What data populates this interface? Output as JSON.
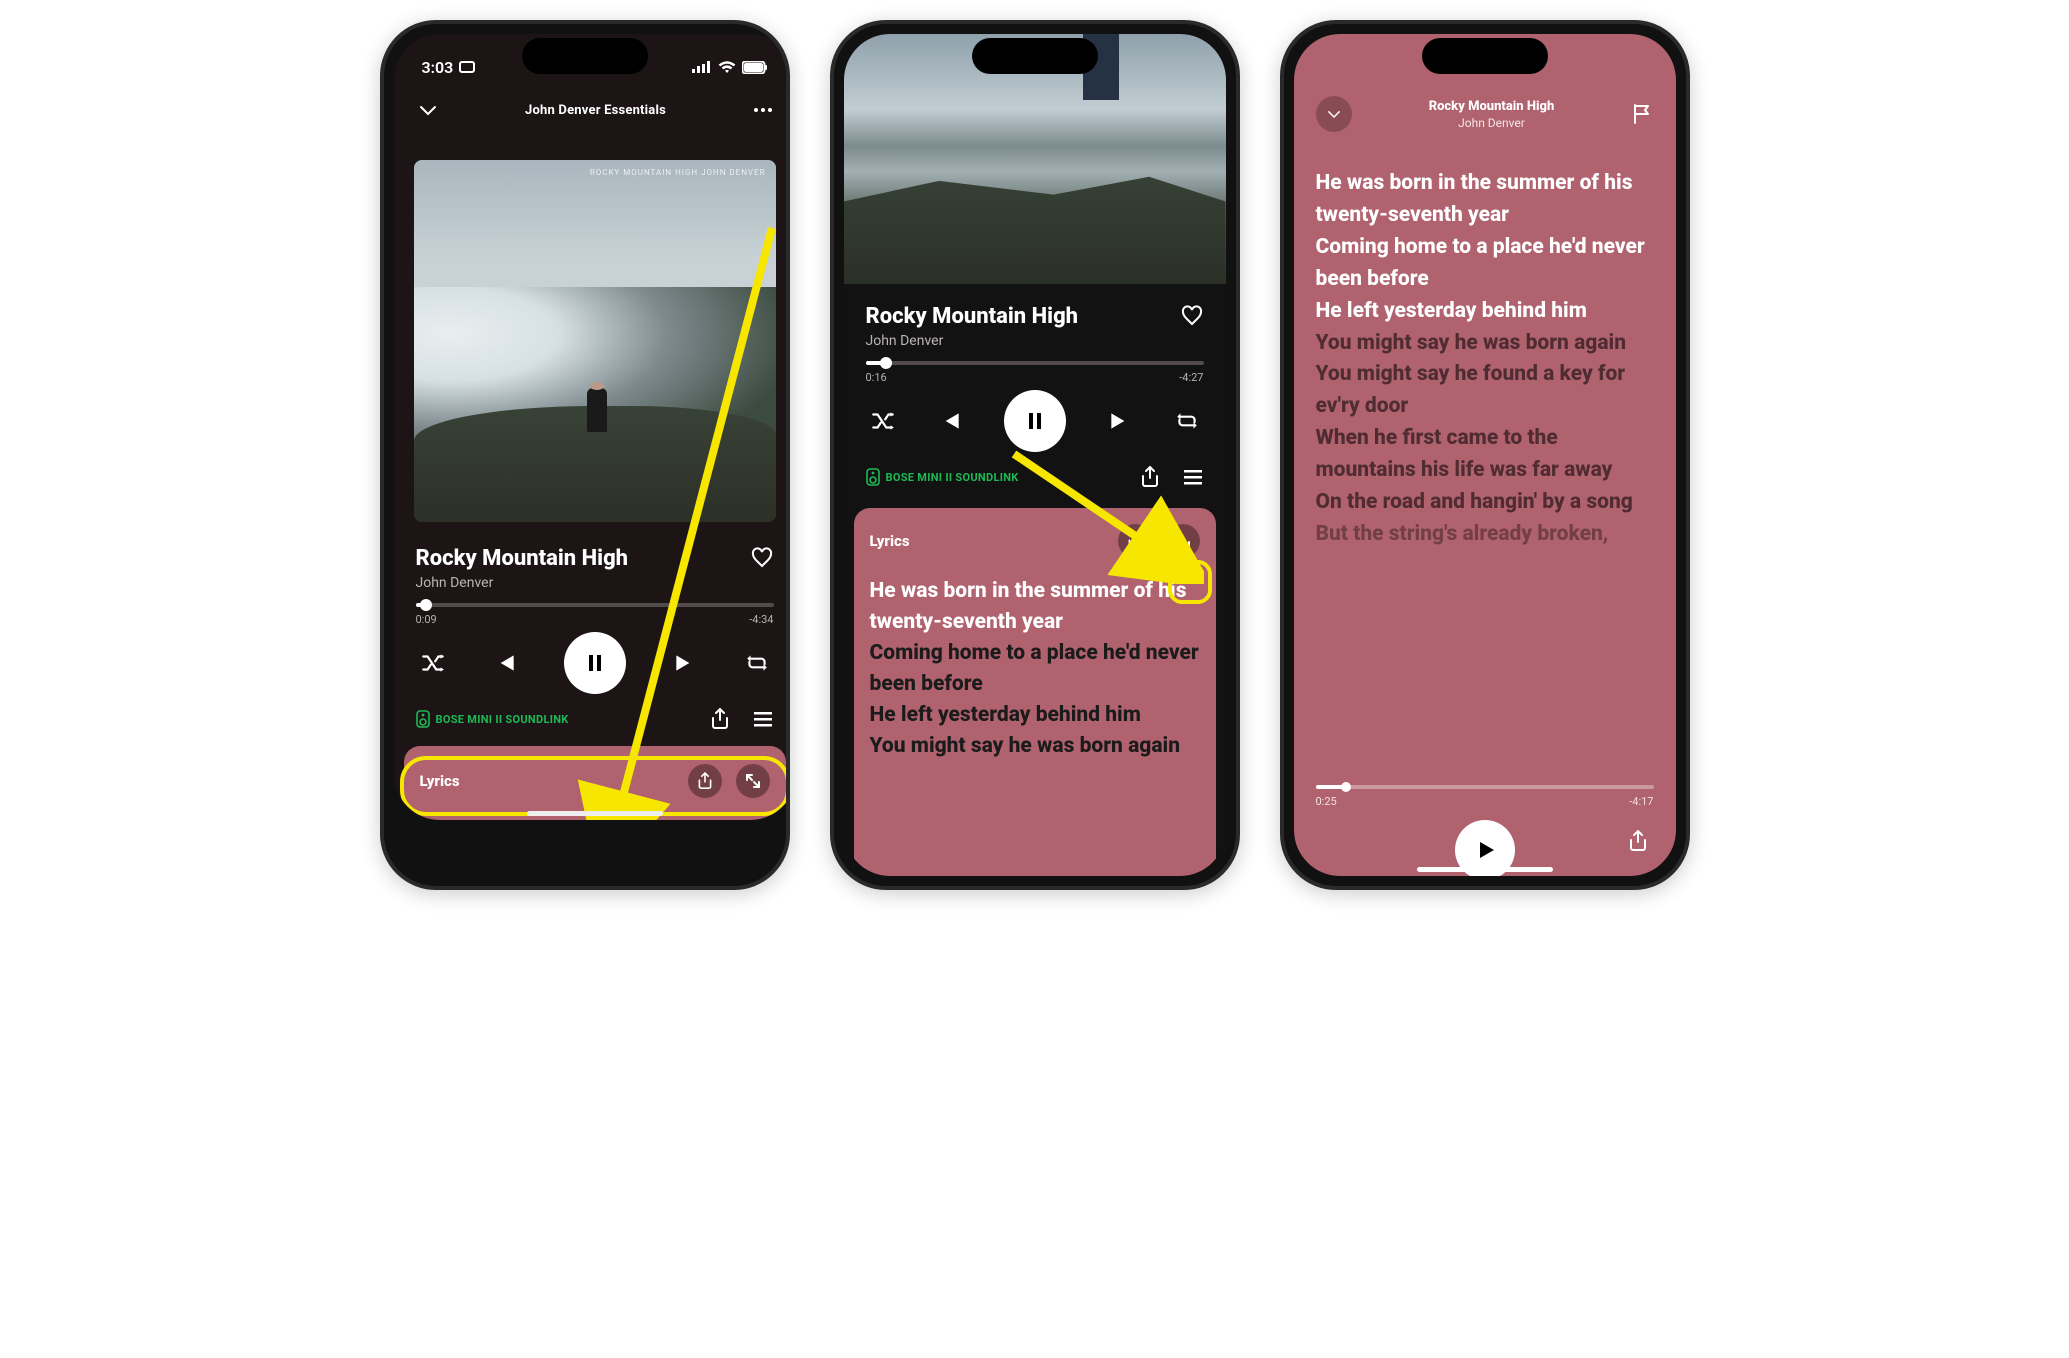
{
  "status": {
    "time": "3:03",
    "recording_glyph": "▭"
  },
  "screen1": {
    "context_title": "John Denver Essentials",
    "art_text": "ROCKY MOUNTAIN HIGH JOHN DENVER",
    "track_title": "Rocky Mountain High",
    "track_artist": "John Denver",
    "elapsed": "0:09",
    "remaining": "-4:34",
    "progress_pct": 3,
    "device_name": "BOSE MINI II SOUNDLINK",
    "lyrics_label": "Lyrics"
  },
  "screen2": {
    "track_title": "Rocky Mountain High",
    "track_artist": "John Denver",
    "elapsed": "0:16",
    "remaining": "-4:27",
    "progress_pct": 6,
    "device_name": "BOSE MINI II SOUNDLINK",
    "lyrics_label": "Lyrics",
    "lines": [
      {
        "text": "He was born in the summer of his twenty-seventh year",
        "active": true
      },
      {
        "text": "Coming home to a place he'd never been before",
        "active": false
      },
      {
        "text": "He left yesterday behind him",
        "active": false
      },
      {
        "text": "You might say he was born again",
        "active": false
      }
    ]
  },
  "screen3": {
    "track_title": "Rocky Mountain High",
    "track_artist": "John Denver",
    "elapsed": "0:25",
    "remaining": "-4:17",
    "progress_pct": 9,
    "lines": [
      {
        "text": "He was born in the summer of his twenty-seventh year",
        "style": "active"
      },
      {
        "text": "Coming home to a place he'd never been before",
        "style": "active"
      },
      {
        "text": "He left yesterday behind him",
        "style": "active"
      },
      {
        "text": "You might say he was born again",
        "style": "muted"
      },
      {
        "text": "You might say he found a key for ev'ry door",
        "style": "muted"
      },
      {
        "text": "When he first came to the mountains his life was far away",
        "style": "muted"
      },
      {
        "text": "On the road and hangin' by a song",
        "style": "muted"
      },
      {
        "text": "But the string's already broken,",
        "style": "fade"
      }
    ]
  }
}
